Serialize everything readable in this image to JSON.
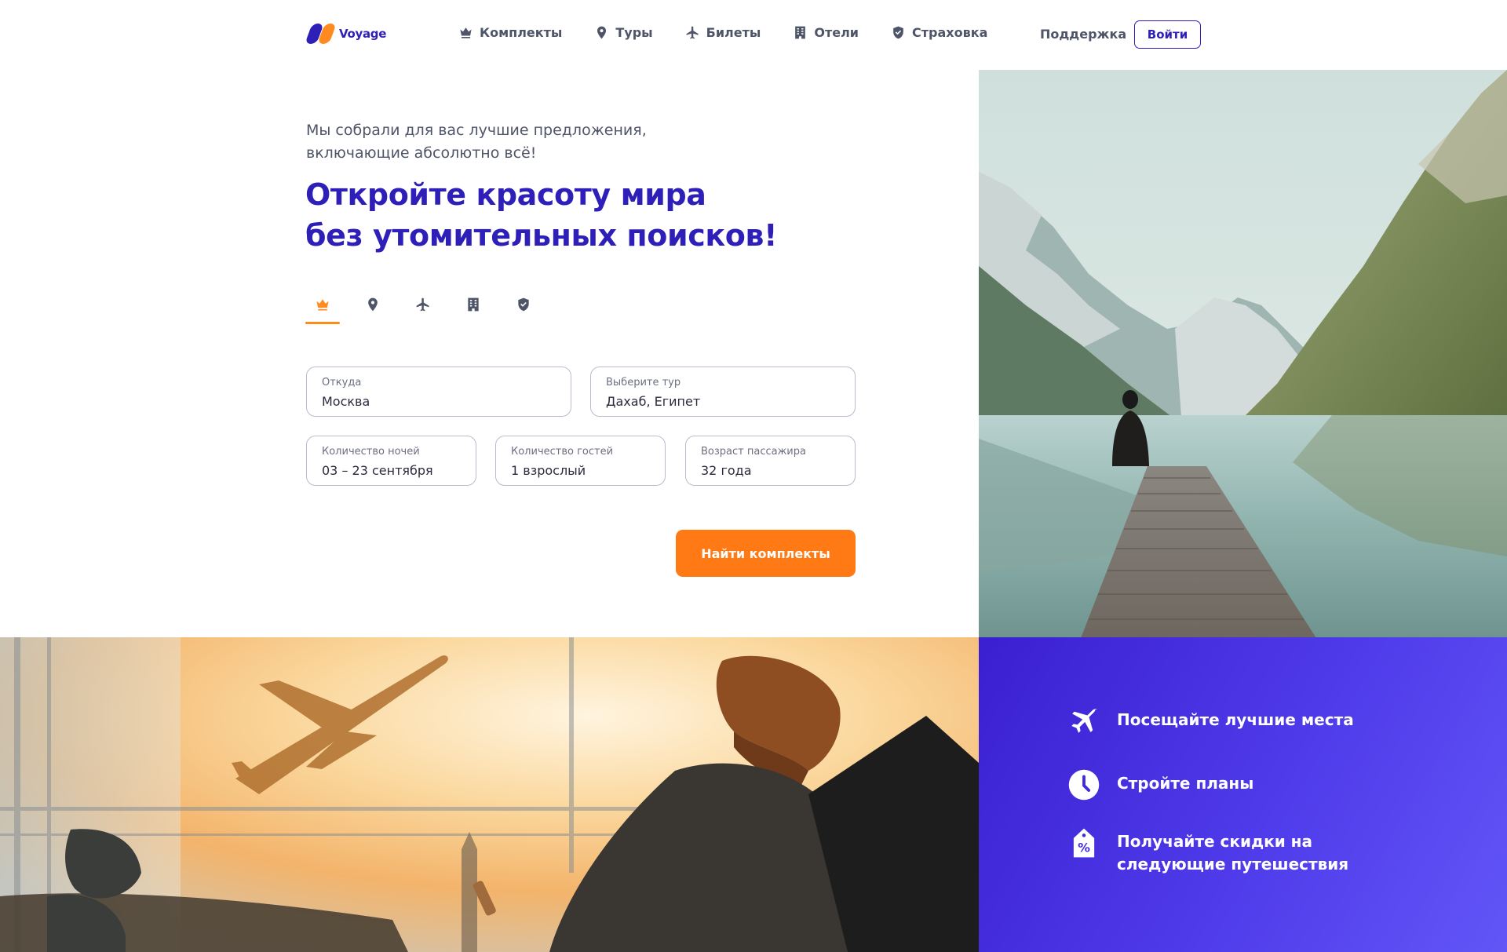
{
  "brand": {
    "name": "Voyage",
    "colors": {
      "primary": "#2e1fb8",
      "accent": "#ff8a1f"
    }
  },
  "nav": {
    "items": [
      {
        "label": "Комплекты",
        "icon": "crown-icon"
      },
      {
        "label": "Туры",
        "icon": "map-pin-icon"
      },
      {
        "label": "Билеты",
        "icon": "airplane-icon"
      },
      {
        "label": "Отели",
        "icon": "building-icon"
      },
      {
        "label": "Страховка",
        "icon": "shield-icon"
      }
    ],
    "support_label": "Поддержка",
    "login_label": "Войти"
  },
  "hero": {
    "tagline": "Мы собрали для вас лучшие предложения, включающие абсолютно всё!",
    "headline_line1": "Откройте красоту мира",
    "headline_line2": "без утомительных поисков!",
    "tabs": [
      {
        "icon": "crown-icon",
        "active": true
      },
      {
        "icon": "map-pin-icon",
        "active": false
      },
      {
        "icon": "airplane-icon",
        "active": false
      },
      {
        "icon": "building-icon",
        "active": false
      },
      {
        "icon": "shield-icon",
        "active": false
      }
    ]
  },
  "search": {
    "from": {
      "label": "Откуда",
      "value": "Москва"
    },
    "tour": {
      "label": "Выберите тур",
      "value": "Дахаб, Египет"
    },
    "nights": {
      "label": "Количество ночей",
      "value": "03 – 23 сентября"
    },
    "guests": {
      "label": "Количество гостей",
      "value": "1 взрослый"
    },
    "age": {
      "label": "Возраст пассажира",
      "value": "32 года"
    },
    "submit_label": "Найти комплекты"
  },
  "features": [
    {
      "icon": "airplane-icon",
      "text": "Посещайте лучшие места"
    },
    {
      "icon": "clock-icon",
      "text": "Стройте планы"
    },
    {
      "icon": "discount-tag-icon",
      "text": "Получайте скидки на следующие путешествия"
    }
  ]
}
